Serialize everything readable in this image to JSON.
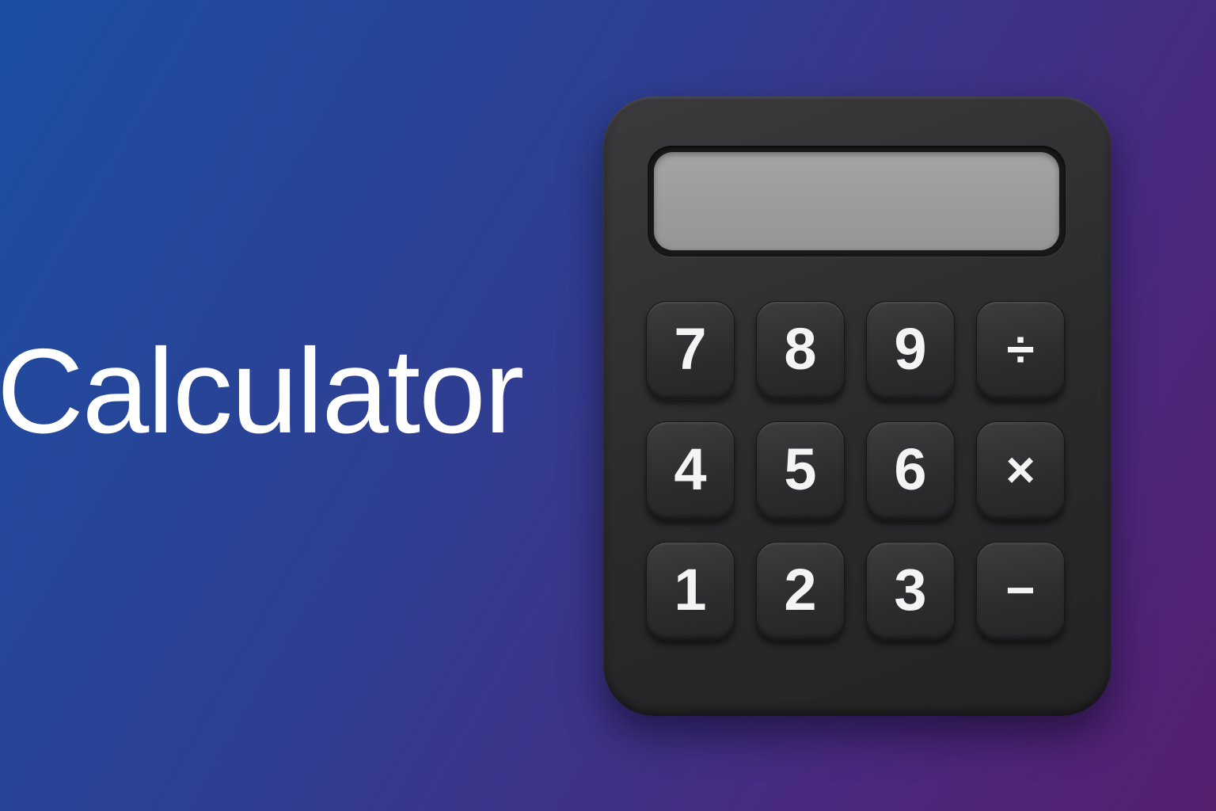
{
  "title": "Calculator",
  "display": {
    "value": ""
  },
  "keypad": {
    "keys": [
      {
        "label": "7",
        "type": "digit"
      },
      {
        "label": "8",
        "type": "digit"
      },
      {
        "label": "9",
        "type": "digit"
      },
      {
        "label": "÷",
        "type": "operator"
      },
      {
        "label": "4",
        "type": "digit"
      },
      {
        "label": "5",
        "type": "digit"
      },
      {
        "label": "6",
        "type": "digit"
      },
      {
        "label": "×",
        "type": "operator"
      },
      {
        "label": "1",
        "type": "digit"
      },
      {
        "label": "2",
        "type": "digit"
      },
      {
        "label": "3",
        "type": "digit"
      },
      {
        "label": "−",
        "type": "operator"
      }
    ]
  },
  "colors": {
    "background_start": "#1c4ea2",
    "background_end": "#561f6e",
    "body": "#2c2c2e",
    "screen": "#9e9e9e",
    "key_text": "#f4f4f4",
    "title_text": "#ffffff"
  }
}
